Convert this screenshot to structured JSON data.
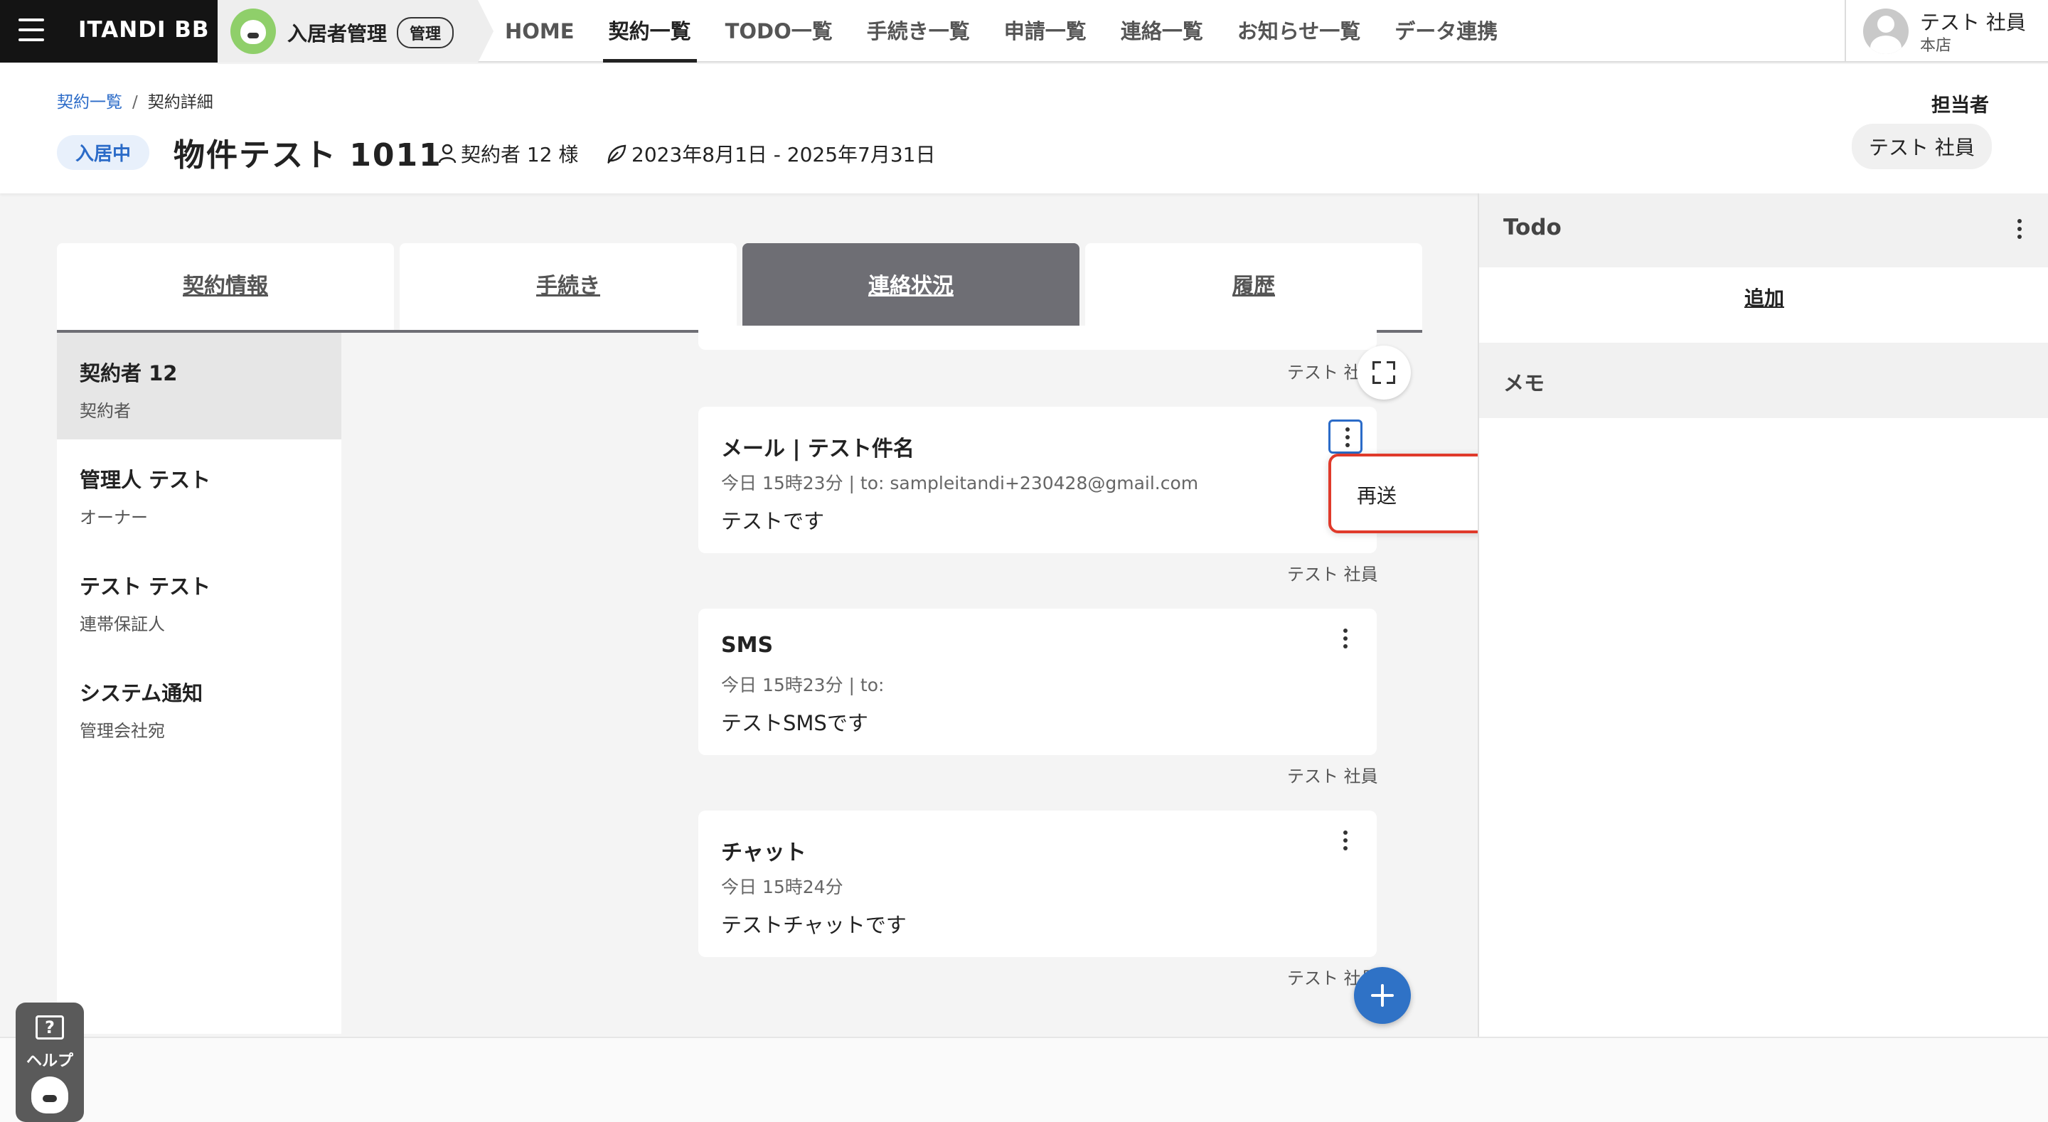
{
  "topbar": {
    "brand": "ITANDI BB",
    "app_name": "入居者管理",
    "app_badge": "管理",
    "nav": [
      "HOME",
      "契約一覧",
      "TODO一覧",
      "手続き一覧",
      "申請一覧",
      "連絡一覧",
      "お知らせ一覧",
      "データ連携"
    ],
    "active_nav": "契約一覧",
    "user_name": "テスト 社員",
    "user_store": "本店"
  },
  "header": {
    "breadcrumb": {
      "link": "契約一覧",
      "sep": "/",
      "current": "契約詳細"
    },
    "status": "入居中",
    "title": "物件テスト 1011",
    "contractor": "契約者 12 様",
    "period": "2023年8月1日 - 2025年7月31日",
    "tanto_label": "担当者",
    "tanto_name": "テスト 社員"
  },
  "tabs": [
    "契約情報",
    "手続き",
    "連絡状況",
    "履歴"
  ],
  "active_tab": "連絡状況",
  "contacts": [
    {
      "name": "契約者 12",
      "role": "契約者"
    },
    {
      "name": "管理人 テスト",
      "role": "オーナー"
    },
    {
      "name": "テスト テスト",
      "role": "連帯保証人"
    },
    {
      "name": "システム通知",
      "role": "管理会社宛"
    }
  ],
  "messages": [
    {
      "title": "メール | テスト件名",
      "meta": "今日 15時23分 | to: sampleitandi+230428@gmail.com",
      "body": "テストです",
      "sender": "テスト 社員"
    },
    {
      "title": "SMS",
      "meta": "今日 15時23分 | to:",
      "body": "テストSMSです",
      "sender": "テスト 社員"
    },
    {
      "title": "チャット",
      "meta": "今日 15時24分",
      "body": "テストチャットです",
      "sender": "テスト 社員"
    }
  ],
  "prev_sender": "テスト 社員",
  "dropdown": {
    "resend": "再送"
  },
  "right_panel": {
    "todo_title": "Todo",
    "todo_add": "追加",
    "memo_title": "メモ"
  },
  "help": {
    "icon": "?",
    "label": "ヘルプ"
  },
  "icons": {
    "menu": "hamburger-icon",
    "person": "person-icon",
    "leaf": "leaf-icon",
    "expand": "expand-icon",
    "add": "plus-icon",
    "more": "more-vertical-icon"
  },
  "colors": {
    "accent": "#2b6bc8",
    "tab_active": "#6e6e74",
    "highlight": "#e03a2b",
    "fab": "#2f72c6"
  }
}
